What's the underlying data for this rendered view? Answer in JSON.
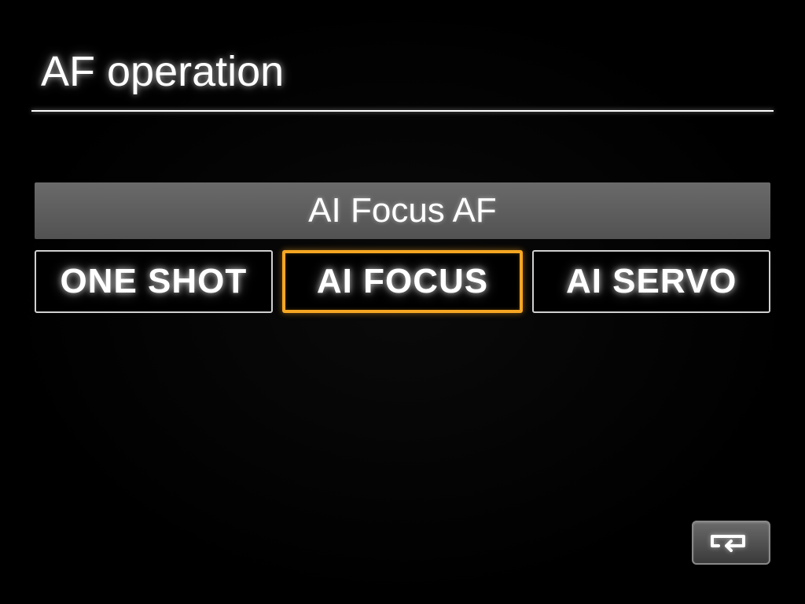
{
  "header": {
    "title": "AF operation"
  },
  "description": {
    "current": "AI Focus AF"
  },
  "options": [
    {
      "label": "ONE SHOT",
      "selected": false
    },
    {
      "label": "AI FOCUS",
      "selected": true
    },
    {
      "label": "AI SERVO",
      "selected": false
    }
  ],
  "colors": {
    "highlight": "#f5a623",
    "background": "#000000",
    "text": "#ffffff",
    "panel": "#5a5a5a"
  }
}
